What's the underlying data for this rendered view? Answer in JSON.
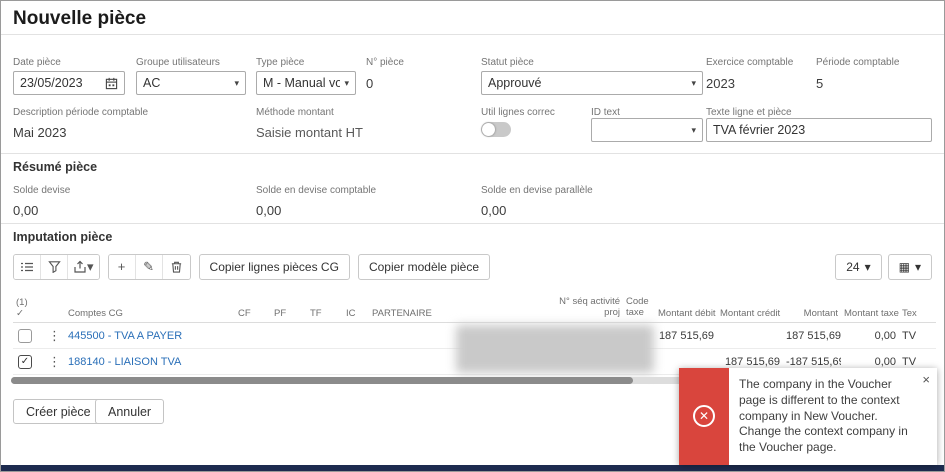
{
  "page": {
    "title": "Nouvelle pièce"
  },
  "icons": {
    "chevron_down": "▾",
    "kebab": "⋮",
    "check": "✓",
    "close": "×",
    "plus": "+",
    "edit": "✎",
    "grid": "▦",
    "error": "✕"
  },
  "form": {
    "date_piece": {
      "label": "Date pièce",
      "value": "23/05/2023"
    },
    "groupe_utilisateurs": {
      "label": "Groupe utilisateurs",
      "value": "AC"
    },
    "type_piece": {
      "label": "Type pièce",
      "value": "M - Manual vo..."
    },
    "no_piece": {
      "label": "N° pièce",
      "value": "0"
    },
    "statut_piece": {
      "label": "Statut pièce",
      "value": "Approuvé"
    },
    "exercice_comptable": {
      "label": "Exercice comptable",
      "value": "2023"
    },
    "periode_comptable": {
      "label": "Période comptable",
      "value": "5"
    },
    "description_periode": {
      "label": "Description période comptable",
      "value": "Mai 2023"
    },
    "methode_montant": {
      "label": "Méthode montant",
      "value": "Saisie montant HT"
    },
    "util_lignes_correc": {
      "label": "Util lignes correc",
      "state": "off"
    },
    "id_text": {
      "label": "ID text",
      "value": ""
    },
    "texte_ligne_piece": {
      "label": "Texte ligne et pièce",
      "value": "TVA février 2023"
    }
  },
  "resume": {
    "title": "Résumé pièce",
    "solde_devise": {
      "label": "Solde devise",
      "value": "0,00"
    },
    "solde_devise_comptable": {
      "label": "Solde en devise comptable",
      "value": "0,00"
    },
    "solde_devise_parallele": {
      "label": "Solde en devise parallèle",
      "value": "0,00"
    }
  },
  "imputation": {
    "title": "Imputation pièce",
    "toolbar": {
      "copier_lignes": "Copier lignes pièces CG",
      "copier_modele": "Copier modèle pièce",
      "page_size": "24"
    },
    "columns": {
      "select": "(1)",
      "comptes": "Comptes CG",
      "cf": "CF",
      "pf": "PF",
      "tf": "TF",
      "ic": "IC",
      "partenaire": "PARTENAIRE",
      "seq_activite": "N° séq activité proj",
      "code_taxe": "Code taxe",
      "montant_debit": "Montant débit",
      "montant_credit": "Montant crédit",
      "montant": "Montant",
      "montant_taxe": "Montant taxe",
      "tex": "Tex"
    },
    "rows": [
      {
        "compte": "445500 - TVA A PAYER",
        "montant_debit": "187 515,69",
        "montant_credit": "",
        "montant": "187 515,69",
        "montant_taxe": "0,00",
        "tex": "TV"
      },
      {
        "compte": "188140 - LIAISON TVA",
        "montant_debit": "",
        "montant_credit": "187 515,69",
        "montant": "-187 515,69",
        "montant_taxe": "0,00",
        "tex": "TV"
      }
    ]
  },
  "footer": {
    "creer": "Créer pièce",
    "annuler": "Annuler"
  },
  "toast": {
    "message": "The company in the Voucher page is different to the context company in New Voucher. Change the context company in the Voucher page."
  }
}
